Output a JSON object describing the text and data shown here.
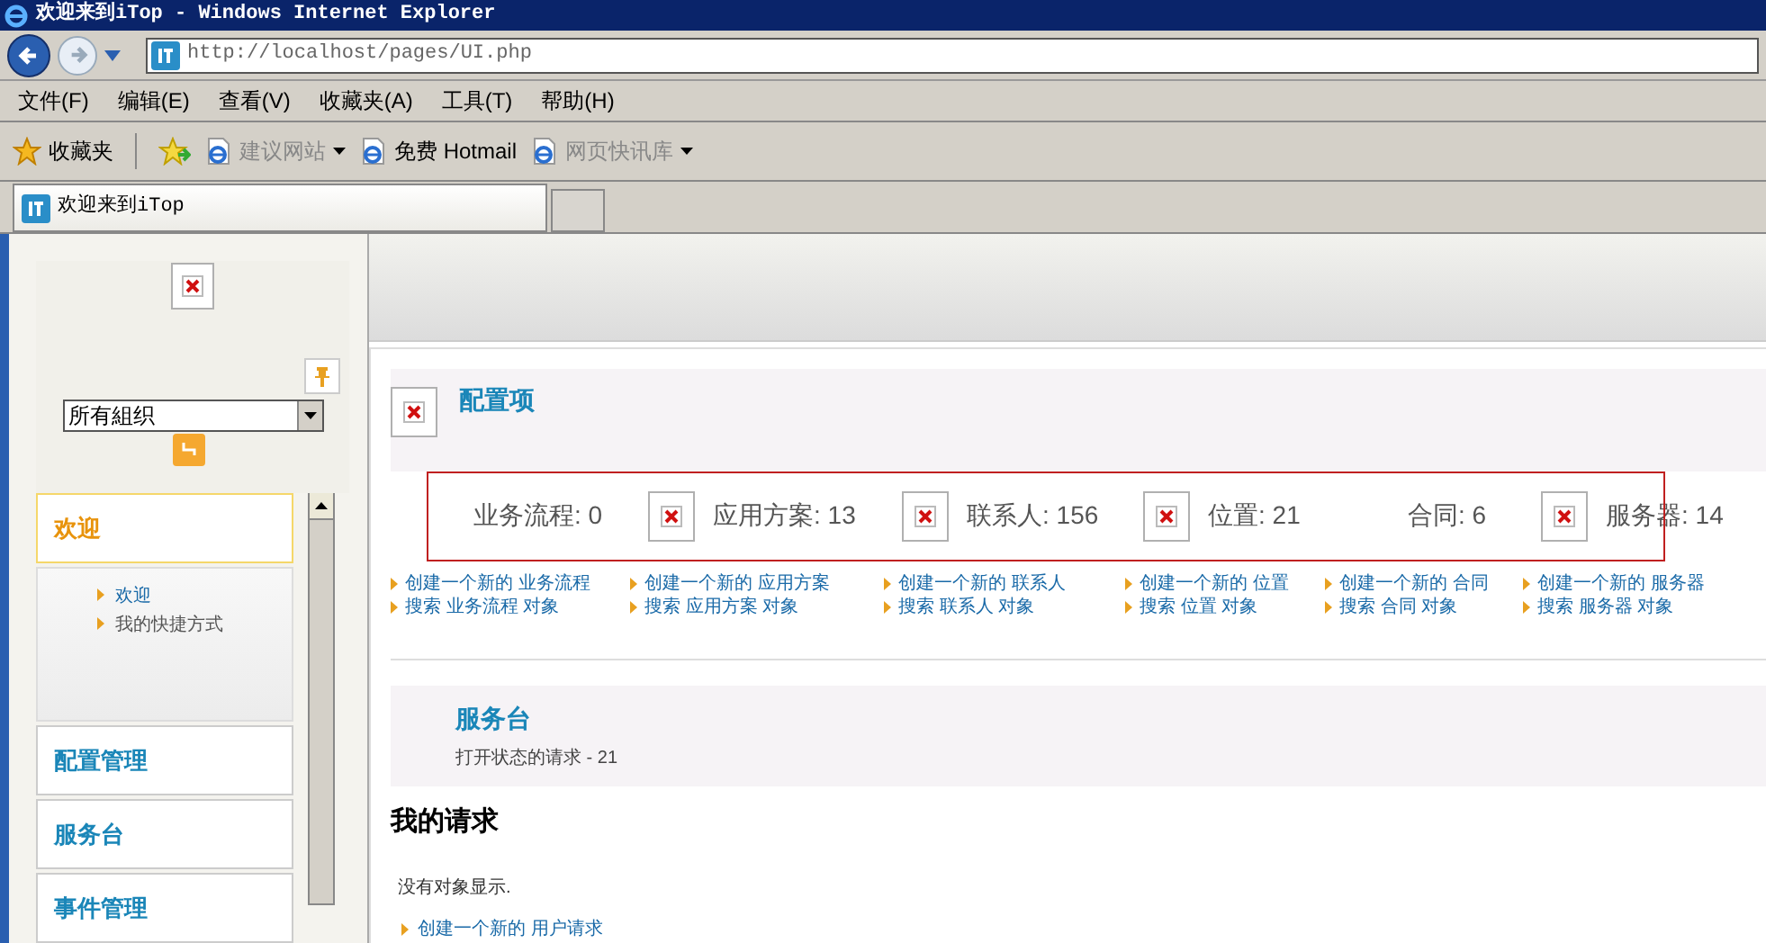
{
  "window": {
    "title": "欢迎来到iTop - Windows Internet Explorer"
  },
  "address_bar": {
    "url": "http://localhost/pages/UI.php"
  },
  "menu_bar": [
    "文件(F)",
    "编辑(E)",
    "查看(V)",
    "收藏夹(A)",
    "工具(T)",
    "帮助(H)"
  ],
  "favorites_bar": {
    "label": "收藏夹",
    "items": [
      {
        "label": "建议网站",
        "dropdown": true,
        "disabled": true
      },
      {
        "label": "免费 Hotmail",
        "dropdown": false,
        "disabled": false
      },
      {
        "label": "网页快讯库",
        "dropdown": true,
        "disabled": true
      }
    ]
  },
  "tabs": [
    {
      "label": "欢迎来到iTop",
      "selected": true
    }
  ],
  "sidebar": {
    "organization_select": {
      "value": "所有組织"
    },
    "sections": [
      {
        "label": "欢迎",
        "expanded": true,
        "items": [
          {
            "label": "欢迎",
            "selected": true
          },
          {
            "label": "我的快捷方式",
            "selected": false
          }
        ]
      },
      {
        "label": "配置管理",
        "expanded": false
      },
      {
        "label": "服务台",
        "expanded": false
      },
      {
        "label": "事件管理",
        "expanded": false
      }
    ]
  },
  "config_items": {
    "title": "配置项",
    "highlighted": true,
    "stats": [
      {
        "label": "业务流程: 0",
        "has_icon": false,
        "create_link": "创建一个新的 业务流程",
        "search_link": "搜索 业务流程 对象"
      },
      {
        "label": "应用方案: 13",
        "has_icon": true,
        "create_link": "创建一个新的 应用方案",
        "search_link": "搜索 应用方案 对象"
      },
      {
        "label": "联系人: 156",
        "has_icon": true,
        "create_link": "创建一个新的 联系人",
        "search_link": "搜索 联系人 对象"
      },
      {
        "label": "位置: 21",
        "has_icon": true,
        "create_link": "创建一个新的 位置",
        "search_link": "搜索 位置 对象"
      },
      {
        "label": "合同: 6",
        "has_icon": false,
        "create_link": "创建一个新的 合同",
        "search_link": "搜索 合同 对象"
      },
      {
        "label": "服务器: 14",
        "has_icon": true,
        "create_link": "创建一个新的 服务器",
        "search_link": "搜索 服务器 对象"
      }
    ]
  },
  "service_desk": {
    "title": "服务台",
    "summary": "打开状态的请求 - 21"
  },
  "my_requests": {
    "title": "我的请求",
    "empty_message": "没有对象显示.",
    "create_link": "创建一个新的 用户请求"
  }
}
